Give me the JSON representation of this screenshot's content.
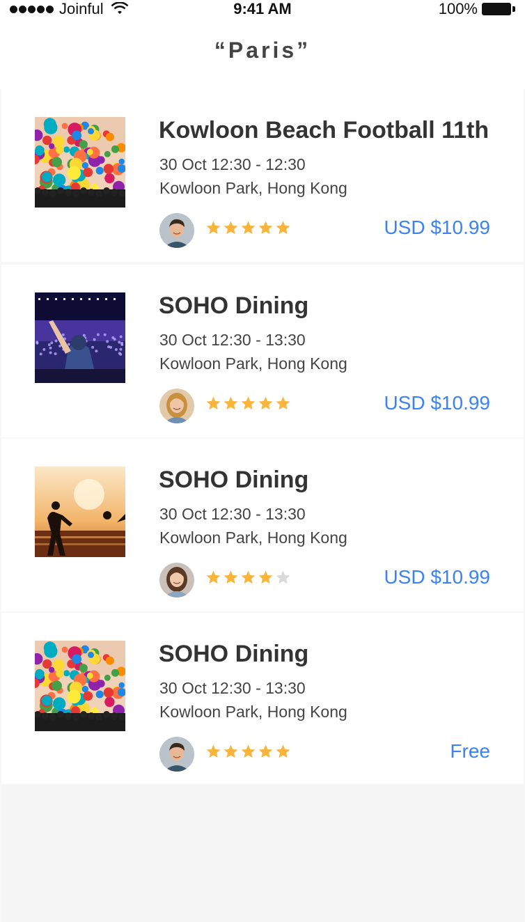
{
  "status_bar": {
    "carrier": "Joinful",
    "time": "9:41 AM",
    "battery": "100%"
  },
  "header": {
    "title": "“Paris”"
  },
  "colors": {
    "accent": "#3b82f6",
    "star_on": "#f9b43b",
    "star_off": "#d9d9d9"
  },
  "events": [
    {
      "title": "Kowloon Beach Football 11th",
      "date": "30 Oct 12:30 - 12:30",
      "location": "Kowloon Park, Hong Kong",
      "price": "USD $10.99",
      "rating": 5,
      "thumb": "balloons",
      "avatar": "man"
    },
    {
      "title": "SOHO Dining",
      "date": "30 Oct 12:30 - 13:30",
      "location": "Kowloon Park, Hong Kong",
      "price": "USD $10.99",
      "rating": 5,
      "thumb": "concert",
      "avatar": "woman-blonde"
    },
    {
      "title": "SOHO Dining",
      "date": "30 Oct 12:30 - 13:30",
      "location": "Kowloon Park, Hong Kong",
      "price": "USD $10.99",
      "rating": 4,
      "thumb": "beach",
      "avatar": "woman-brunette"
    },
    {
      "title": "SOHO Dining",
      "date": "30 Oct 12:30 - 13:30",
      "location": "Kowloon Park, Hong Kong",
      "price": "Free",
      "rating": 5,
      "thumb": "balloons",
      "avatar": "man"
    }
  ]
}
